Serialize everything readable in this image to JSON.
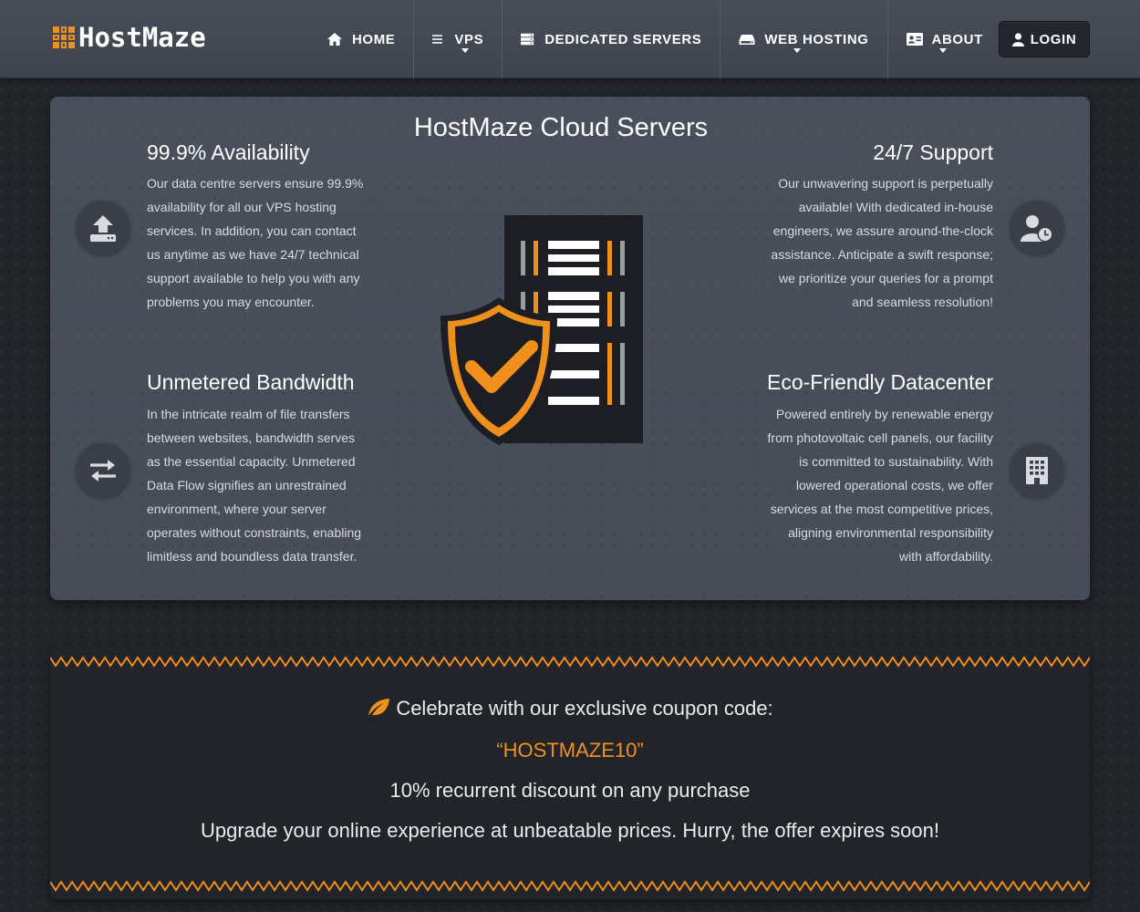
{
  "brand": {
    "name": "HostMaze",
    "accent": "#f0901c"
  },
  "nav": {
    "items": [
      {
        "label": "HOME",
        "icon": "home-icon",
        "dropdown": false
      },
      {
        "label": "VPS",
        "icon": "list-icon",
        "dropdown": true
      },
      {
        "label": "DEDICATED SERVERS",
        "icon": "server-icon",
        "dropdown": false
      },
      {
        "label": "WEB HOSTING",
        "icon": "hdd-icon",
        "dropdown": true
      },
      {
        "label": "ABOUT",
        "icon": "id-card-icon",
        "dropdown": true
      }
    ],
    "login_label": "LOGIN"
  },
  "features": {
    "title": "HostMaze Cloud Servers",
    "items": [
      {
        "title": "99.9% Availability",
        "text": "Our data centre servers ensure 99.9% availability for all our VPS hosting services. In addition, you can contact us anytime as we have 24/7 technical support available to help you with any problems you may encounter.",
        "icon": "upload-icon"
      },
      {
        "title": "24/7 Support",
        "text": "Our unwavering support is perpetually available! With dedicated in-house engineers, we assure around-the-clock assistance. Anticipate a swift response; we prioritize your queries for a prompt and seamless resolution!",
        "icon": "user-clock-icon"
      },
      {
        "title": "Unmetered Bandwidth",
        "text": "In the intricate realm of file transfers between websites, bandwidth serves as the essential capacity. Unmetered Data Flow signifies an unrestrained environment, where your server operates without constraints, enabling limitless and boundless data transfer.",
        "icon": "exchange-icon"
      },
      {
        "title": "Eco-Friendly Datacenter",
        "text": "Powered entirely by renewable energy from photovoltaic cell panels, our facility is committed to sustainability. With lowered operational costs, we offer services at the most competitive prices, aligning environmental responsibility with affordability.",
        "icon": "building-icon"
      }
    ]
  },
  "coupon": {
    "headline": "Celebrate with our exclusive coupon code:",
    "code": "“HOSTMAZE10”",
    "discount": "10% recurrent discount on any purchase",
    "offer": "Upgrade your online experience at unbeatable prices. Hurry, the offer expires soon!",
    "icon": "leaf-icon"
  }
}
